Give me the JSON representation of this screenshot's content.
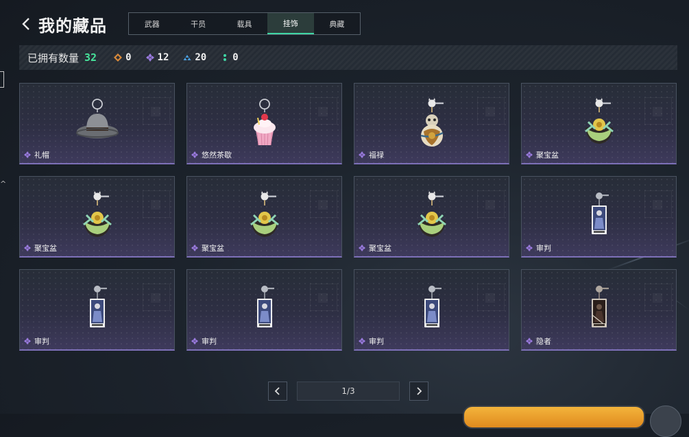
{
  "header": {
    "title": "我的藏品",
    "back_icon": "chevron-left-icon"
  },
  "tabs": [
    {
      "label": "武器",
      "active": false
    },
    {
      "label": "干员",
      "active": false
    },
    {
      "label": "载具",
      "active": false
    },
    {
      "label": "挂饰",
      "active": true
    },
    {
      "label": "典藏",
      "active": false
    }
  ],
  "stats": {
    "owned_label": "已拥有数量",
    "owned_total": "32",
    "rarities": [
      {
        "icon": "orange-diamond-icon",
        "color": "#d98a3a",
        "value": "0"
      },
      {
        "icon": "purple-diamond-icon",
        "color": "#9b7be0",
        "value": "12"
      },
      {
        "icon": "blue-triangle-icon",
        "color": "#4aa0e0",
        "value": "20"
      },
      {
        "icon": "green-dots-icon",
        "color": "#3fd6a4",
        "value": "0"
      }
    ]
  },
  "rarity_color": "#9b7be0",
  "items": [
    {
      "name": "礼帽",
      "kind": "hat"
    },
    {
      "name": "悠然茶歇",
      "kind": "cupcake"
    },
    {
      "name": "福禄",
      "kind": "gourd"
    },
    {
      "name": "聚宝盆",
      "kind": "bowl"
    },
    {
      "name": "聚宝盆",
      "kind": "bowl"
    },
    {
      "name": "聚宝盆",
      "kind": "bowl"
    },
    {
      "name": "聚宝盆",
      "kind": "bowl"
    },
    {
      "name": "审判",
      "kind": "card"
    },
    {
      "name": "审判",
      "kind": "card"
    },
    {
      "name": "审判",
      "kind": "card"
    },
    {
      "name": "审判",
      "kind": "card"
    },
    {
      "name": "隐者",
      "kind": "card-dark"
    }
  ],
  "pager": {
    "page": "1/3"
  },
  "accent": "#3fd6a4",
  "total_highlight": "#47e39b"
}
